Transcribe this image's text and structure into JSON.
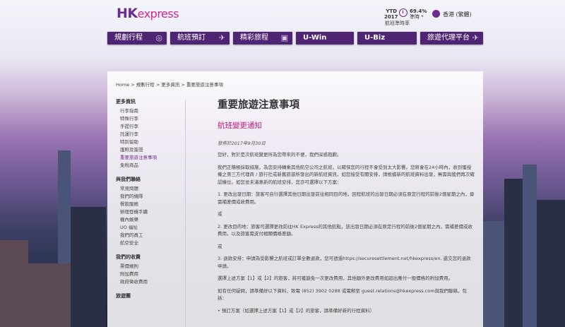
{
  "header": {
    "logo_hk": "HK",
    "logo_express": "express",
    "ytd_label": "YTD 2017",
    "ontime_pct": "69.4%",
    "ontime_suffix": "準時 *",
    "ontime_sub": "航班準時率",
    "language": "香港 (繁體)"
  },
  "nav": [
    {
      "label": "規劃行程",
      "icon": "compass-icon",
      "glyph": "◎"
    },
    {
      "label": "航班預訂",
      "icon": "plane-icon",
      "glyph": "✈"
    },
    {
      "label": "精彩旅程",
      "icon": "camera-icon",
      "glyph": "▣"
    },
    {
      "label": "U-Win",
      "icon": "",
      "glyph": ""
    },
    {
      "label": "U-Biz",
      "icon": "",
      "glyph": ""
    },
    {
      "label": "旅遊代理平台",
      "icon": "plane-icon",
      "glyph": "✈"
    }
  ],
  "breadcrumb": "Home > 規劃行程 > 更多資訊 > 重要旅遊注意事項",
  "sidebar": {
    "groups": [
      {
        "title": "更多資訊",
        "items": [
          "行李指南",
          "特殊行李",
          "手提行李",
          "託運行李",
          "特別協助",
          "護照及簽證",
          "重要旅遊注意事項",
          "免稅商品"
        ]
      },
      {
        "title": "與我們聯絡",
        "items": [
          "常見問題",
          "我們的機隊",
          "餐飲服務",
          "辦理登機手續",
          "機內娛樂",
          "UO 福址",
          "我們的員工",
          "航空安全"
        ]
      },
      {
        "title": "我們的收費",
        "items": [
          "票價規則",
          "附加費用",
          "政府徵收費用"
        ]
      },
      {
        "title": "旅遊團",
        "items": []
      }
    ],
    "active_item": "重要旅遊注意事項"
  },
  "content": {
    "title": "重要旅遊注意事項",
    "subtitle": "航班變更通知",
    "date": "發佈於2017年9月30日",
    "paragraphs": [
      "您好，對於是次航班變更所為您帶來的不便，我們深感抱歉。",
      "我們正積極採取措施，為您安排轉乘其他航空公司之航班，以確保您的行程不會受到太大影響。您將會在24小時內，收到獲授權之第三方代理商 / 旅行社或新舊旅遊所發出的新航班資訊，如您接受有關安排，請根據新的航班資料出發，無需與我們再次確認機位。如您並未滿意新的航班安排，您亦可選擇以下方案：",
      "1. 更改出發日期：旅客可自行選擇其他日期出發前往相同目的地，回程航班的出發日期必須在原定行程的前後2個星期之內，毋需補差價或收費用。",
      "或",
      "2. 更改目的地：旅客可選擇更改前往HK Express的其他航點，該出發日期必須在原定行程的前後2個星期之內，需補差價或收費用。以及旅客需支付相關價格差額。",
      "或",
      "3. 退款安排：申請為受影響之航班或訂單全數退款，您可透過https://securesettlement.net/hkexpress/en. 遞交您的退款申請。",
      "選擇上述方案【1】或【2】的旅客，將可獲豁免一次更改費用，其他額外更改費用如超出應付一般價格的附加費用。",
      "如有任何疑問，請準備好以下資料，致電 (852) 3902 0288 或電郵至 guest.relations@hkexpress.com與我們聯絡，包括：",
      "• 預訂方案（如選擇上述方案【1】或【2】的旅客，請準備好新的行程資料）"
    ]
  }
}
